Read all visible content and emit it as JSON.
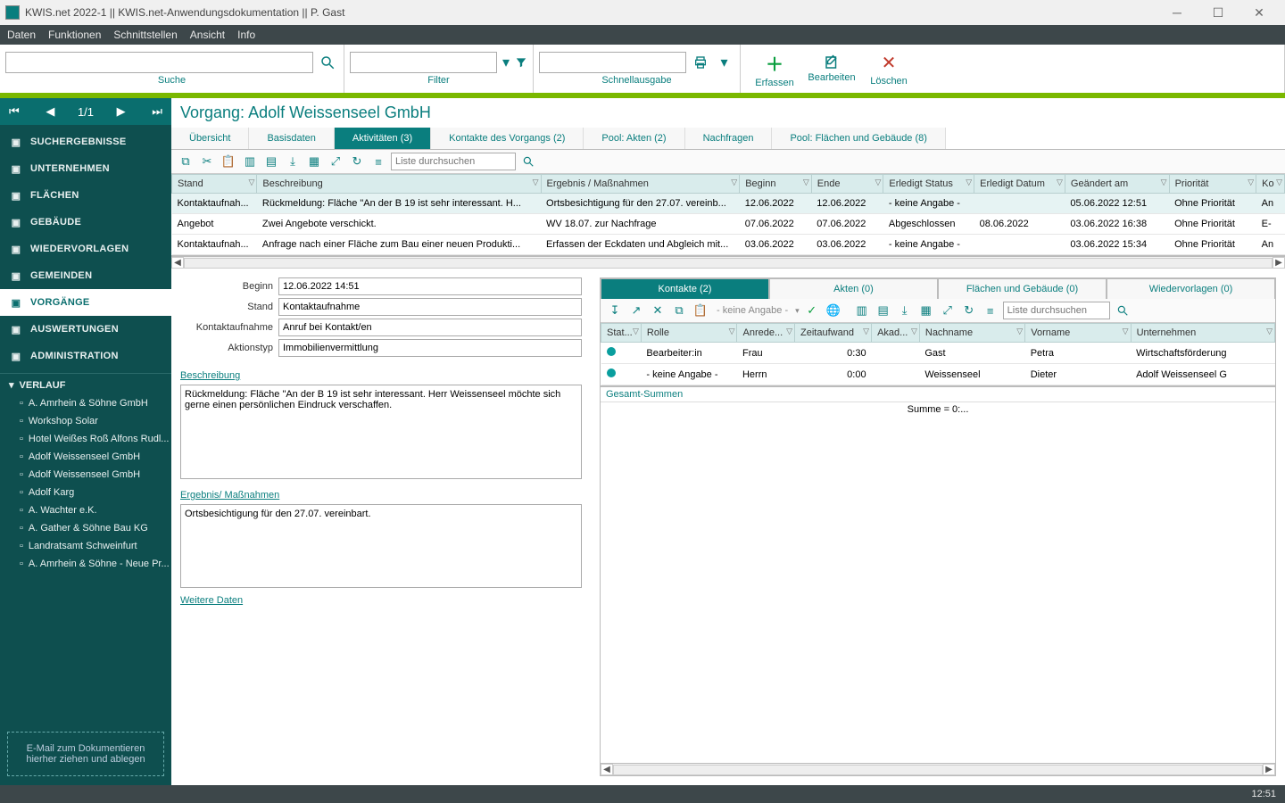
{
  "window": {
    "title": "KWIS.net 2022-1 || KWIS.net-Anwendungsdokumentation || P. Gast"
  },
  "menubar": [
    "Daten",
    "Funktionen",
    "Schnittstellen",
    "Ansicht",
    "Info"
  ],
  "toolbar": {
    "search_label": "Suche",
    "filter_label": "Filter",
    "quick_label": "Schnellausgabe",
    "erfassen": "Erfassen",
    "bearbeiten": "Bearbeiten",
    "loeschen": "Löschen"
  },
  "sidebar": {
    "nav_count": "1/1",
    "items": [
      {
        "label": "SUCHERGEBNISSE"
      },
      {
        "label": "UNTERNEHMEN"
      },
      {
        "label": "FLÄCHEN"
      },
      {
        "label": "GEBÄUDE"
      },
      {
        "label": "WIEDERVORLAGEN"
      },
      {
        "label": "GEMEINDEN"
      },
      {
        "label": "VORGÄNGE"
      },
      {
        "label": "AUSWERTUNGEN"
      },
      {
        "label": "ADMINISTRATION"
      }
    ],
    "history_head": "VERLAUF",
    "history": [
      "A. Amrhein & Söhne GmbH",
      "Workshop Solar",
      "Hotel Weißes Roß Alfons Rudl...",
      "Adolf Weissenseel GmbH",
      "Adolf Weissenseel GmbH",
      "Adolf Karg",
      "A. Wachter e.K.",
      "A. Gather & Söhne Bau KG",
      "Landratsamt Schweinfurt",
      "A. Amrhein & Söhne - Neue Pr..."
    ],
    "dropzone": "E-Mail  zum Dokumentieren hierher ziehen und ablegen"
  },
  "heading": "Vorgang: Adolf Weissenseel GmbH",
  "main_tabs": [
    "Übersicht",
    "Basisdaten",
    "Aktivitäten (3)",
    "Kontakte des Vorgangs (2)",
    "Pool: Akten (2)",
    "Nachfragen",
    "Pool: Flächen und Gebäude (8)"
  ],
  "list_search_placeholder": "Liste durchsuchen",
  "grid": {
    "cols": [
      "Stand",
      "Beschreibung",
      "Ergebnis / Maßnahmen",
      "Beginn",
      "Ende",
      "Erledigt Status",
      "Erledigt Datum",
      "Geändert am",
      "Priorität",
      "Ko"
    ],
    "rows": [
      {
        "stand": "Kontaktaufnah...",
        "beschr": "Rückmeldung: Fläche \"An der B 19 ist sehr interessant. H...",
        "erg": "Ortsbesichtigung für den 27.07. vereinb...",
        "beginn": "12.06.2022",
        "ende": "12.06.2022",
        "status": "- keine Angabe -",
        "edatum": "",
        "geaendert": "05.06.2022 12:51",
        "prio": "Ohne Priorität",
        "ko": "An"
      },
      {
        "stand": "Angebot",
        "beschr": "Zwei Angebote verschickt.",
        "erg": "WV 18.07. zur Nachfrage",
        "beginn": "07.06.2022",
        "ende": "07.06.2022",
        "status": "Abgeschlossen",
        "edatum": "08.06.2022",
        "geaendert": "03.06.2022 16:38",
        "prio": "Ohne Priorität",
        "ko": "E-"
      },
      {
        "stand": "Kontaktaufnah...",
        "beschr": "Anfrage nach einer Fläche zum Bau einer neuen Produkti...",
        "erg": "Erfassen der Eckdaten und Abgleich mit...",
        "beginn": "03.06.2022",
        "ende": "03.06.2022",
        "status": "- keine Angabe -",
        "edatum": "",
        "geaendert": "03.06.2022 15:34",
        "prio": "Ohne Priorität",
        "ko": "An"
      }
    ]
  },
  "detail": {
    "beginn_label": "Beginn",
    "beginn": "12.06.2022 14:51",
    "stand_label": "Stand",
    "stand": "Kontaktaufnahme",
    "kontakt_label": "Kontaktaufnahme",
    "kontakt": "Anruf bei Kontakt/en",
    "aktion_label": "Aktionstyp",
    "aktion": "Immobilienvermittlung",
    "beschr_label": "Beschreibung",
    "beschr": "Rückmeldung: Fläche \"An der B 19 ist sehr interessant. Herr Weissenseel möchte sich gerne einen persönlichen Eindruck verschaffen.",
    "erg_label": "Ergebnis/ Maßnahmen",
    "erg": "Ortsbesichtigung für den 27.07. vereinbart.",
    "weitere": "Weitere Daten"
  },
  "right_tabs": [
    "Kontakte (2)",
    "Akten (0)",
    "Flächen und Gebäude (0)",
    "Wiedervorlagen (0)"
  ],
  "right_dropdown": "- keine Angabe -",
  "contacts_grid": {
    "cols": [
      "Stat...",
      "Rolle",
      "Anrede...",
      "Zeitaufwand",
      "Akad...",
      "Nachname",
      "Vorname",
      "Unternehmen"
    ],
    "rows": [
      {
        "rolle": "Bearbeiter:in",
        "anrede": "Frau",
        "zeit": "0:30",
        "akad": "",
        "nach": "Gast",
        "vor": "Petra",
        "unt": "Wirtschaftsförderung"
      },
      {
        "rolle": "- keine Angabe -",
        "anrede": "Herrn",
        "zeit": "0:00",
        "akad": "",
        "nach": "Weissenseel",
        "vor": "Dieter",
        "unt": "Adolf Weissenseel G"
      }
    ],
    "sum_label": "Gesamt-Summen",
    "sum_value": "Summe = 0:..."
  },
  "status_time": "12:51"
}
